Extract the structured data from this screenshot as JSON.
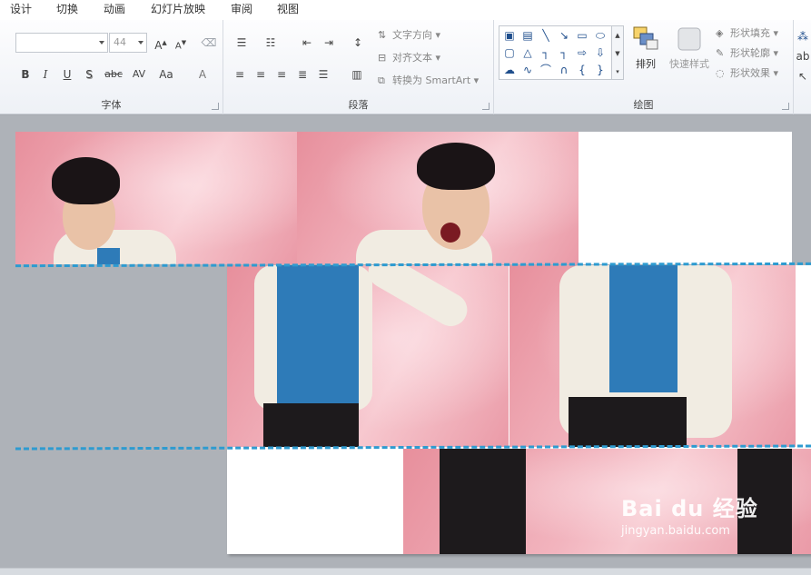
{
  "tabs": [
    "设计",
    "切换",
    "动画",
    "幻灯片放映",
    "审阅",
    "视图"
  ],
  "ribbon": {
    "font_group": {
      "label": "字体",
      "font_name": "",
      "font_size": "44",
      "buttons": [
        "B",
        "I",
        "U",
        "S",
        "abc",
        "AV",
        "Aa",
        "A"
      ],
      "grow_shrink": [
        "A",
        "A"
      ]
    },
    "paragraph_group": {
      "label": "段落",
      "text_direction": "文字方向",
      "align_text": "对齐文本",
      "convert_smartart": "转换为 SmartArt"
    },
    "drawing_group": {
      "label": "绘图",
      "arrange": "排列",
      "quick_styles": "快速样式",
      "shape_fill": "形状填充",
      "shape_outline": "形状轮廓",
      "shape_effects": "形状效果"
    }
  },
  "watermark": {
    "logo_text": "Bai du 经验",
    "url": "jingyan.baidu.com"
  },
  "colors": {
    "dash_line": "#2e9bd0",
    "photo_bg": "#f2b4be",
    "workspace": "#aeb2b8"
  }
}
